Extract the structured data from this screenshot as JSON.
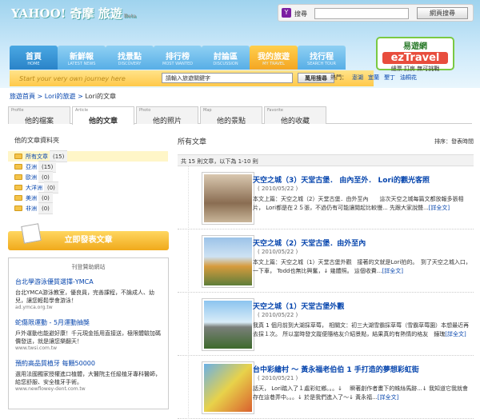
{
  "header": {
    "logo": "YAHOO! 奇摩 旅遊",
    "beta": "Beta",
    "search_label": "搜尋",
    "search_button": "網頁搜尋"
  },
  "nav": [
    {
      "zh": "首頁",
      "en": "HOME"
    },
    {
      "zh": "新鮮報",
      "en": "LATEST NEWS"
    },
    {
      "zh": "找景點",
      "en": "DISCOVERY"
    },
    {
      "zh": "排行榜",
      "en": "MOST WANTED"
    },
    {
      "zh": "討論區",
      "en": "DISCUSSION"
    },
    {
      "zh": "我的旅遊",
      "en": "MY TRAVEL"
    },
    {
      "zh": "找行程",
      "en": "SEARCH TOUR"
    }
  ],
  "ad_logo": {
    "a": "易遊網",
    "b": "ezTravel",
    "c": "總票 訂房 無可挑戰"
  },
  "journey": {
    "placeholder": "Start your very own journey here",
    "input": "請輸入旅遊關鍵字",
    "button": "萬用搜尋",
    "hot_label": "熱門：",
    "hot": [
      "澎湖",
      "宜蘭",
      "墾丁",
      "油桐花"
    ]
  },
  "breadcrumb": {
    "a": "旅遊首頁",
    "sep": " > ",
    "b": "Lori的旅遊",
    "c": "Lori的文章"
  },
  "tabs": [
    {
      "en": "Profile",
      "zh": "他的檔案"
    },
    {
      "en": "Article",
      "zh": "他的文章"
    },
    {
      "en": "Photo",
      "zh": "他的照片"
    },
    {
      "en": "Map",
      "zh": "他的景點"
    },
    {
      "en": "Favorite",
      "zh": "他的收藏"
    }
  ],
  "folders": {
    "title": "他的文章資料夾",
    "items": [
      {
        "name": "所有文章",
        "count": "(15)"
      },
      {
        "name": "亞洲",
        "count": "(15)"
      },
      {
        "name": "歐洲",
        "count": "(0)"
      },
      {
        "name": "大洋洲",
        "count": "(0)"
      },
      {
        "name": "美洲",
        "count": "(0)"
      },
      {
        "name": "非洲",
        "count": "(0)"
      }
    ]
  },
  "post_button": "立即發表文章",
  "ads": {
    "title": "刊登贊助網站",
    "items": [
      {
        "t": "台北學游泳優質選擇-YMCA",
        "d": "台北YMCA游泳教室，優良員，完善課程，不論成人、幼兒，讓您輕鬆學會游泳！",
        "u": "ad.ymca.org.tw"
      },
      {
        "t": "蛇傷限運動 - 5月運動抽獎",
        "d": "戶外運動也能避好康！千元現金抵用直接送，極限體驗加碼價發送，就是讓您樂翻天！",
        "u": "www.twsi.com.tw"
      },
      {
        "t": "預約高品質植牙 每顆50000",
        "d": "選用法國獨家授權進口植體，大醫院主任級植牙專科醫師，給您舒服、安全植牙手術。",
        "u": "www.newflowey-dent.com.tw"
      }
    ]
  },
  "main": {
    "title": "所有文章",
    "sort": "排序：發表時間",
    "count": "共 15 則文章，以下為 1-10 則"
  },
  "posts": [
    {
      "title": "天空之城（3）天堂古堡． 由內至外． Lori的觀光客照",
      "date": "( 2010/05/22 )",
      "excerpt": "本文上篇：天空之城（2）天堂古堡．由外至內　　這次天空之城每篇文都放報多張相片，  Lori都是在２５張，不過仍有可能讓閱起比較慢...  先跟大家說聲...",
      "more": "[詳全文]"
    },
    {
      "title": "天空之城（2）天堂古堡．由外至內",
      "date": "( 2010/05/22 )",
      "excerpt": "本文上篇：天空之城（1）天堂古堡外觀　接著的文就是Lori拍的。　到了天空之城入口，一下車，  Todd也無比興奮，↓  幾體照。  這個收費...",
      "more": "[詳全文]"
    },
    {
      "title": "天空之城（1）天堂古堡外觀",
      "date": "( 2010/05/22 )",
      "excerpt": "我真 1 個月前到大湖採草莓，  相關文：初三大湖雪霸採草莓（雪霸草莓園）本想最近再去採１次。  所以當時發文蹤便隨格友介紹景點，結果真的有熱情的格友　鐘瑰",
      "more": "[詳全文]"
    },
    {
      "title": "台中彩繪村 ～ 黃永福老伯伯 1 手打造的夢想彩虹街",
      "date": "( 2010/05/21 )",
      "excerpt": "話天，  Lori踏入了１處彩虹鄉。。。↓　  瞬著創作者畫下的蛛絲馬跡...↓  我知道它我就會存在這巷弄中。。。↓  於是我們進入了～↓  黃永福...",
      "more": "[詳全文]"
    }
  ]
}
